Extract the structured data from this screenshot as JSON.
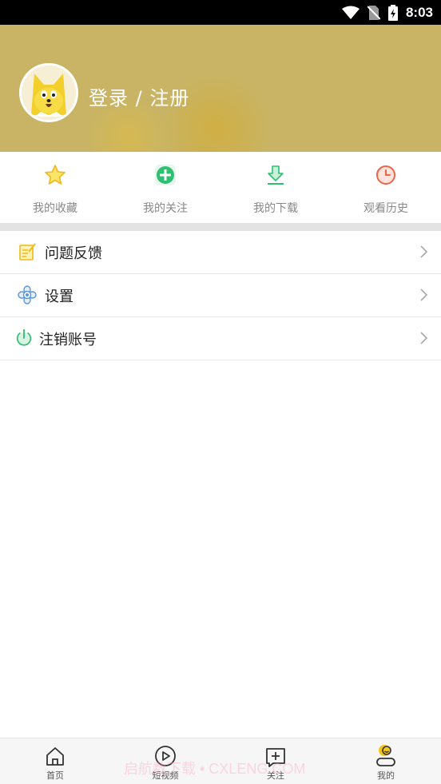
{
  "status_bar": {
    "time": "8:03"
  },
  "header": {
    "login_text": "登录 / 注册",
    "background_color": "#c8b464"
  },
  "quick_actions": [
    {
      "label": "我的收藏",
      "icon": "star-icon",
      "color": "#f5c518"
    },
    {
      "label": "我的关注",
      "icon": "plus-circle-icon",
      "color": "#2fbf71"
    },
    {
      "label": "我的下载",
      "icon": "download-icon",
      "color": "#2fbf71"
    },
    {
      "label": "观看历史",
      "icon": "history-clock-icon",
      "color": "#f0654a"
    }
  ],
  "menu": [
    {
      "label": "问题反馈",
      "icon": "feedback-note-icon"
    },
    {
      "label": "设置",
      "icon": "settings-flower-icon"
    },
    {
      "label": "注销账号",
      "icon": "power-icon"
    }
  ],
  "bottom_nav": [
    {
      "label": "首页",
      "icon": "home-icon"
    },
    {
      "label": "短视频",
      "icon": "play-circle-icon"
    },
    {
      "label": "关注",
      "icon": "plus-square-icon"
    },
    {
      "label": "我的",
      "icon": "profile-icon",
      "active": true
    }
  ],
  "watermark": "启航数下载 • CXLENG.COM"
}
